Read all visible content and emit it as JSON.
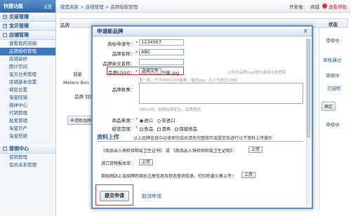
{
  "sidebar": {
    "title": "快捷功能",
    "settings": "设置",
    "sections": [
      {
        "label": "交易管理",
        "toggle": "+"
      },
      {
        "label": "宝贝管理",
        "toggle": "+"
      },
      {
        "label": "店铺管理",
        "toggle": "-"
      }
    ],
    "items": [
      "查看我的店铺",
      "品牌授权管理",
      "店铺装修",
      "图片空间",
      "宝贝分类管理",
      "店铺基本设置",
      "域名设置",
      "淘宝旺铺",
      "媒体中心",
      "代销管理",
      "批发管理",
      "淘宝贝产",
      "淘宝贷款"
    ],
    "active_index": 1,
    "bottom_section": {
      "label": "营销中心",
      "toggle": "-"
    },
    "bottom_items": [
      "促销管理",
      "会员关系管理"
    ]
  },
  "topbar": {
    "breadcrumb": [
      "我是卖家",
      "店铺管理",
      "品牌授权管理"
    ],
    "separator": " > ",
    "developer_label": "开发者：",
    "developer_value": "商城",
    "exit_label": "查看帮助"
  },
  "background": {
    "col_header": "状态",
    "texts": [
      "品牌",
      "羽星",
      "Meters Bon",
      "品牌 羽星",
      "申请新品牌"
    ],
    "statuses": [
      "审核中",
      "审核通过",
      "审核中",
      "已授权",
      "审核中"
    ],
    "confirm_button": "确定"
  },
  "modal": {
    "title": "申请新品牌",
    "close_symbol": "×",
    "fields": {
      "reg_number_label": "商标申请号：",
      "reg_number_value": "1234567",
      "brand_name_label": "品牌名称：",
      "brand_name_value": "ABC",
      "brand_en_label": "品牌英文名称：",
      "brand_en_value": "",
      "logo_label": "品牌LOGO：",
      "logo_button": "选择文件",
      "logo_file": "万能.jpg",
      "logo_hint_right": "上传的品牌logo图与商标注册图保",
      "logo_hint_below": "第一款，尺寸400x300像素，格式jpg，大小不超过100K",
      "story_label": "品牌故事：",
      "story_hint": "500以内，说明品牌定位，品牌理念",
      "source_label": "商品来源：",
      "source_options": [
        "进口",
        "非进口"
      ],
      "source_selected": 0,
      "mode_label": "经营范围：",
      "mode_options": [
        "食品",
        "酒类",
        "保健食品"
      ]
    },
    "docs": {
      "section_title": "资料上传",
      "section_desc": "以上品牌信息中必填项完成后请先完整填写或提交后进行以下资料上传操作",
      "doc1_label": "《商品出入境检验检疫卫生证书》 或 《商品出入境检验检疫卫生证明》：",
      "doc1_button": "上传",
      "doc2_label": "进口货物报关单：",
      "doc2_button": "上传",
      "doc3_label": "商标网站上该品牌的商标注册信息及状态查询信息，打印后盖公章上传：",
      "doc3_button": "上传"
    },
    "actions": {
      "submit": "提交申请",
      "cancel": "取消申请"
    }
  }
}
